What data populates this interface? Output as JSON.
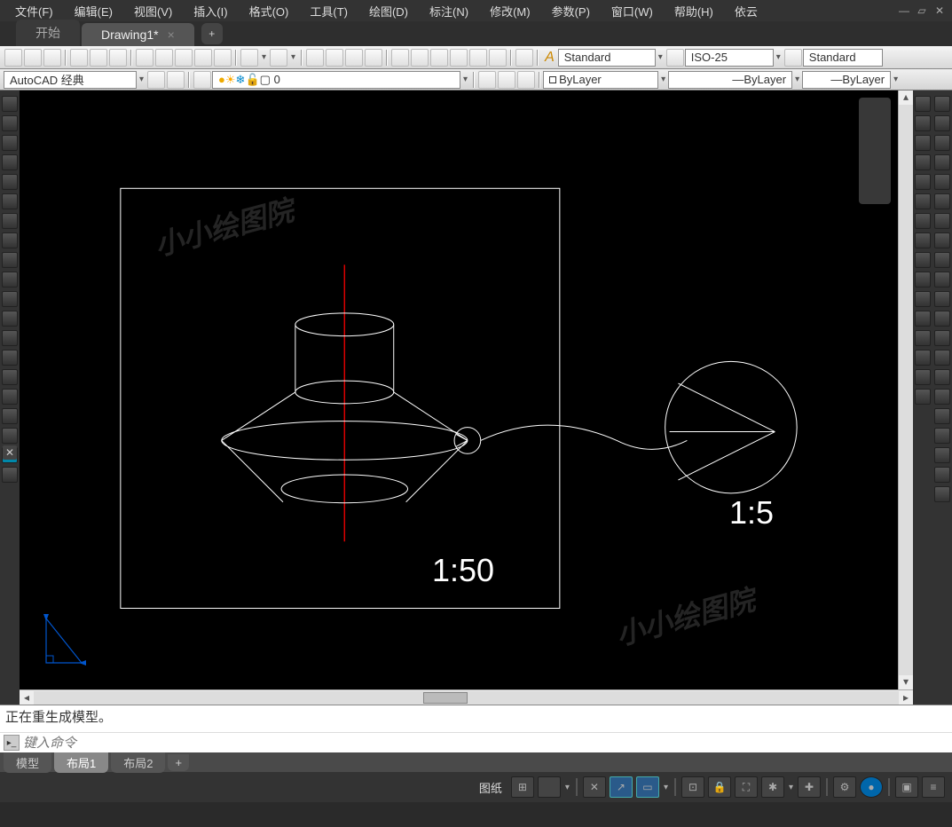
{
  "menu": {
    "file": "文件(F)",
    "edit": "编辑(E)",
    "view": "视图(V)",
    "insert": "插入(I)",
    "format": "格式(O)",
    "tools": "工具(T)",
    "draw": "绘图(D)",
    "dim": "标注(N)",
    "modify": "修改(M)",
    "param": "参数(P)",
    "window": "窗口(W)",
    "help": "帮助(H)",
    "extra": "依云"
  },
  "tabs": {
    "start": "开始",
    "drawing": "Drawing1*"
  },
  "toolbar": {
    "workspace": "AutoCAD 经典",
    "layer": "0",
    "textstyle": "Standard",
    "dimstyle": "ISO-25",
    "tablestyle": "Standard",
    "bylayer1": "ByLayer",
    "bylayer2": "ByLayer",
    "bylayer3": "ByLayer"
  },
  "canvas": {
    "watermark": "小小绘图院",
    "scale1": "1:50",
    "scale2": "1:5"
  },
  "cmd": {
    "status": "正在重生成模型。",
    "placeholder": "键入命令"
  },
  "layout": {
    "model": "模型",
    "layout1": "布局1",
    "layout2": "布局2"
  },
  "statusbar": {
    "paper": "图纸"
  }
}
